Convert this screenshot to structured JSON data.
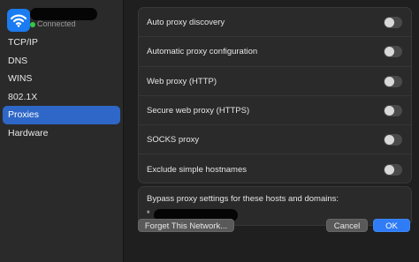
{
  "sidebar": {
    "network": {
      "name": "",
      "status": "Connected",
      "status_color": "#33c748",
      "icon": "wifi-icon"
    },
    "items": [
      {
        "label": "TCP/IP"
      },
      {
        "label": "DNS"
      },
      {
        "label": "WINS"
      },
      {
        "label": "802.1X"
      },
      {
        "label": "Proxies"
      },
      {
        "label": "Hardware"
      }
    ],
    "selected": "Proxies"
  },
  "proxies": {
    "rows": [
      {
        "label": "Auto proxy discovery",
        "enabled": false
      },
      {
        "label": "Automatic proxy configuration",
        "enabled": false
      },
      {
        "label": "Web proxy (HTTP)",
        "enabled": false
      },
      {
        "label": "Secure web proxy (HTTPS)",
        "enabled": false
      },
      {
        "label": "SOCKS proxy",
        "enabled": false
      },
      {
        "label": "Exclude simple hostnames",
        "enabled": false
      }
    ],
    "bypass_label": "Bypass proxy settings for these hosts and domains:",
    "bypass_value_prefix": "*"
  },
  "footer": {
    "forget_label": "Forget This Network...",
    "cancel_label": "Cancel",
    "ok_label": "OK"
  },
  "colors": {
    "accent": "#2e67c7",
    "ok_button": "#2f7cf6"
  }
}
